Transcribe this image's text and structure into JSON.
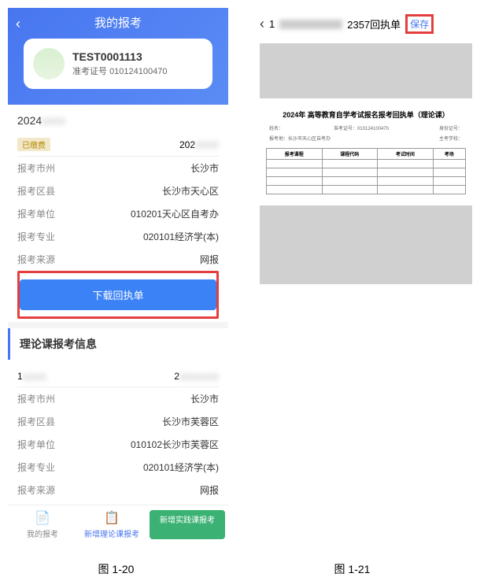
{
  "left": {
    "header_title": "我的报考",
    "user": {
      "id": "TEST0001113",
      "ticket_label": "准考证号",
      "ticket_value": "010124100470"
    },
    "year": "2024",
    "status_tag": "已缴费",
    "status_right": "202",
    "fields": [
      {
        "k": "报考市州",
        "v": "长沙市"
      },
      {
        "k": "报考区县",
        "v": "长沙市天心区"
      },
      {
        "k": "报考单位",
        "v": "010201天心区自考办"
      },
      {
        "k": "报考专业",
        "v": "020101经济学(本)"
      },
      {
        "k": "报考来源",
        "v": "网报"
      }
    ],
    "download_btn": "下载回执单",
    "section2_title": "理论课报考信息",
    "section2_left": "1",
    "section2_right": "2",
    "fields2": [
      {
        "k": "报考市州",
        "v": "长沙市"
      },
      {
        "k": "报考区县",
        "v": "长沙市芙蓉区"
      },
      {
        "k": "报考单位",
        "v": "010102长沙市芙蓉区"
      },
      {
        "k": "报考专业",
        "v": "020101经济学(本)"
      },
      {
        "k": "报考来源",
        "v": "网报"
      }
    ],
    "nav": {
      "item1": "我的报考",
      "item2": "新增理论课报考",
      "item3": "新增实践课报考"
    }
  },
  "right": {
    "header_suffix": "2357回执单",
    "save_btn": "保存",
    "doc_title": "2024年    高等教育自学考试报名报考回执单（理论课）",
    "doc_meta_left": "姓名：",
    "doc_meta_id": "准考证号：010124100470",
    "doc_meta_right": "身份证号：",
    "doc_row2_left": "报考地：长沙市天心区自考办",
    "doc_row2_right": "主考学校：",
    "table_headers": [
      "报考课程",
      "课程代码",
      "考试时间",
      "考场"
    ],
    "table_rows": [
      [
        "",
        "",
        "",
        ""
      ],
      [
        "",
        "",
        "",
        ""
      ],
      [
        "",
        "",
        "",
        ""
      ],
      [
        "",
        "",
        "",
        ""
      ]
    ]
  },
  "captions": {
    "left": "图 1-20",
    "right": "图 1-21"
  }
}
